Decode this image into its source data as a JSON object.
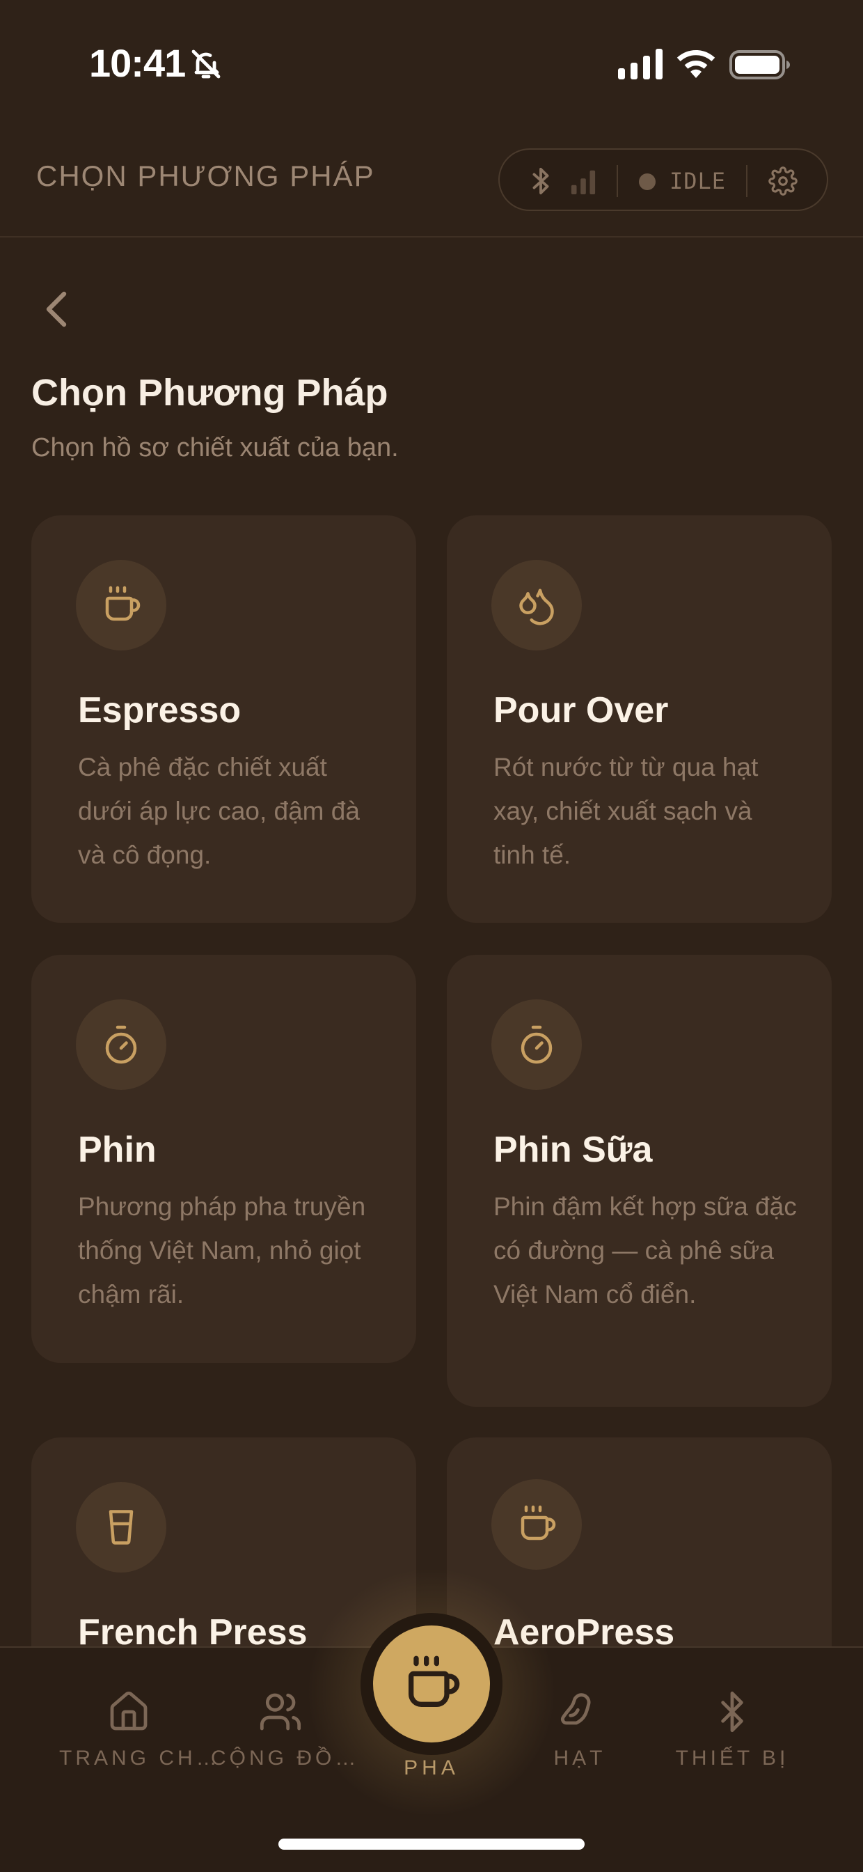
{
  "status_bar": {
    "time": "10:41"
  },
  "header": {
    "title": "CHỌN PHƯƠNG PHÁP",
    "device_status": "IDLE"
  },
  "page": {
    "title": "Chọn Phương Pháp",
    "subtitle": "Chọn hồ sơ chiết xuất của bạn."
  },
  "methods": [
    {
      "name": "Espresso",
      "description": "Cà phê đặc chiết xuất dưới áp lực cao, đậm đà và cô đọng.",
      "icon": "coffee-cup-icon"
    },
    {
      "name": "Pour Over",
      "description": "Rót nước từ từ qua hạt xay, chiết xuất sạch và tinh tế.",
      "icon": "droplets-icon"
    },
    {
      "name": "Phin",
      "description": "Phương pháp pha truyền thống Việt Nam, nhỏ giọt chậm rãi.",
      "icon": "timer-icon"
    },
    {
      "name": "Phin Sữa",
      "description": "Phin đậm kết hợp sữa đặc có đường — cà phê sữa Việt Nam cổ điển.",
      "icon": "timer-icon"
    },
    {
      "name": "French Press",
      "description": "",
      "icon": "glass-icon"
    },
    {
      "name": "AeroPress",
      "description": "",
      "icon": "coffee-cup-icon"
    }
  ],
  "tabs": [
    {
      "label": "TRANG CH…",
      "icon": "home-icon"
    },
    {
      "label": "CỘNG ĐỒ…",
      "icon": "users-icon"
    },
    {
      "label": "PHA",
      "icon": "coffee-cup-icon",
      "active": true
    },
    {
      "label": "HẠT",
      "icon": "bean-icon"
    },
    {
      "label": "THIẾT BỊ",
      "icon": "bluetooth-icon"
    }
  ],
  "colors": {
    "background": "#2f2218",
    "card": "#3a2b20",
    "accent": "#cfa861",
    "muted_text": "#8e7866"
  }
}
